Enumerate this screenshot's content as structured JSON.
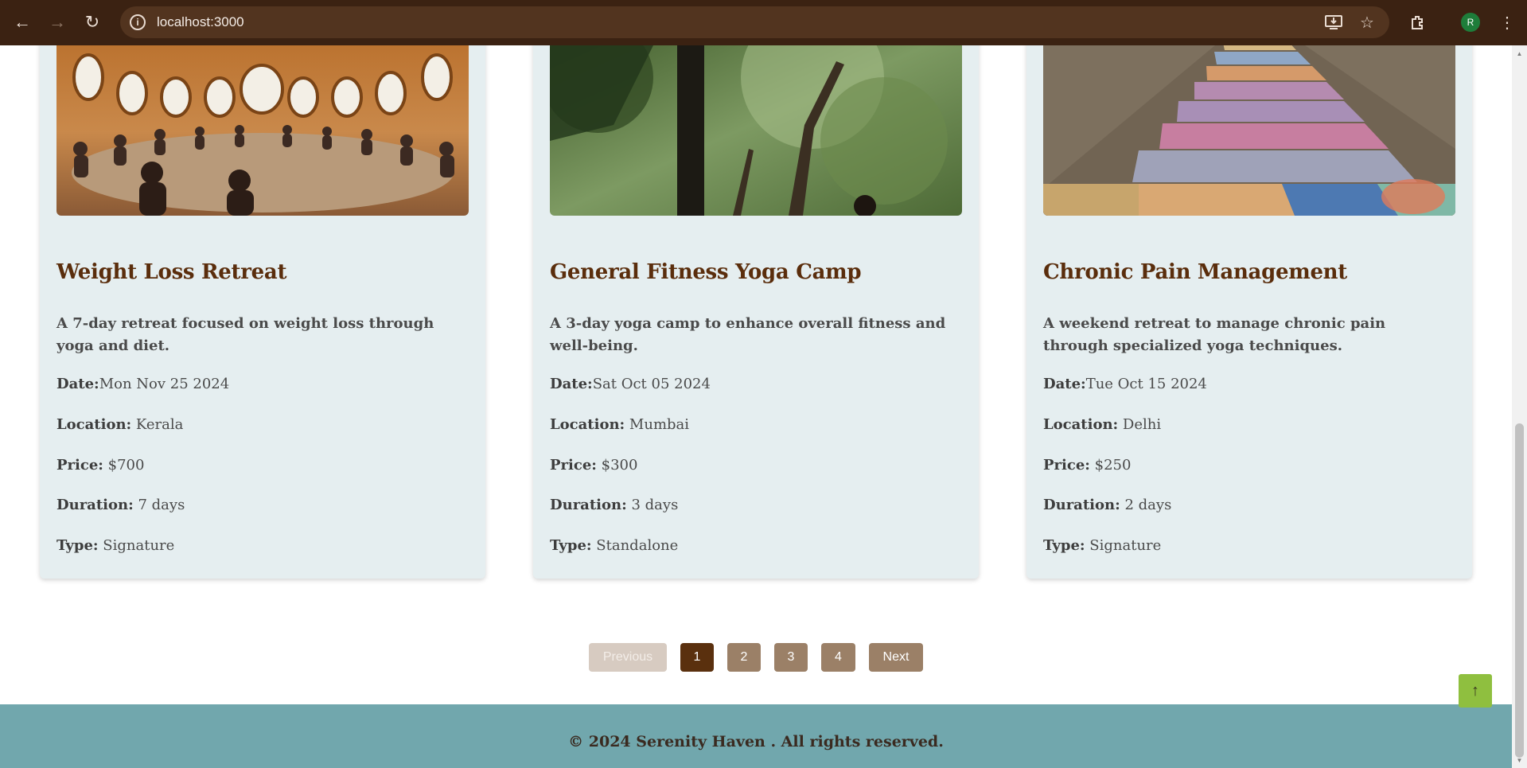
{
  "browser": {
    "url": "localhost:3000",
    "avatar_letter": "R",
    "back_icon": "←",
    "forward_icon": "→",
    "reload_icon": "↻"
  },
  "cards": [
    {
      "title": "Weight Loss Retreat",
      "description": "A 7-day retreat focused on weight loss through yoga and diet.",
      "date_label": "Date:",
      "date": "Mon Nov 25 2024",
      "location_label": "Location:",
      "location": "Kerala",
      "price_label": "Price:",
      "price": "$700",
      "duration_label": "Duration:",
      "duration": "7 days",
      "type_label": "Type:",
      "type": "Signature"
    },
    {
      "title": "General Fitness Yoga Camp",
      "description": "A 3-day yoga camp to enhance overall fitness and well-being.",
      "date_label": "Date:",
      "date": "Sat Oct 05 2024",
      "location_label": "Location:",
      "location": "Mumbai",
      "price_label": "Price:",
      "price": "$300",
      "duration_label": "Duration:",
      "duration": "3 days",
      "type_label": "Type:",
      "type": "Standalone"
    },
    {
      "title": "Chronic Pain Management",
      "description": "A weekend retreat to manage chronic pain through specialized yoga techniques.",
      "date_label": "Date:",
      "date": "Tue Oct 15 2024",
      "location_label": "Location:",
      "location": "Delhi",
      "price_label": "Price:",
      "price": "$250",
      "duration_label": "Duration:",
      "duration": "2 days",
      "type_label": "Type:",
      "type": "Signature"
    }
  ],
  "pagination": {
    "previous": "Previous",
    "pages": [
      "1",
      "2",
      "3",
      "4"
    ],
    "current": "1",
    "next": "Next"
  },
  "footer": {
    "text": "© 2024 Serenity Haven . All rights reserved.",
    "back_to_top_icon": "↑"
  },
  "colors": {
    "accent_brown": "#5a300e",
    "footer_teal": "#71a7ad",
    "back_to_top_green": "#8fbf3f",
    "card_bg": "#e5eef0"
  }
}
